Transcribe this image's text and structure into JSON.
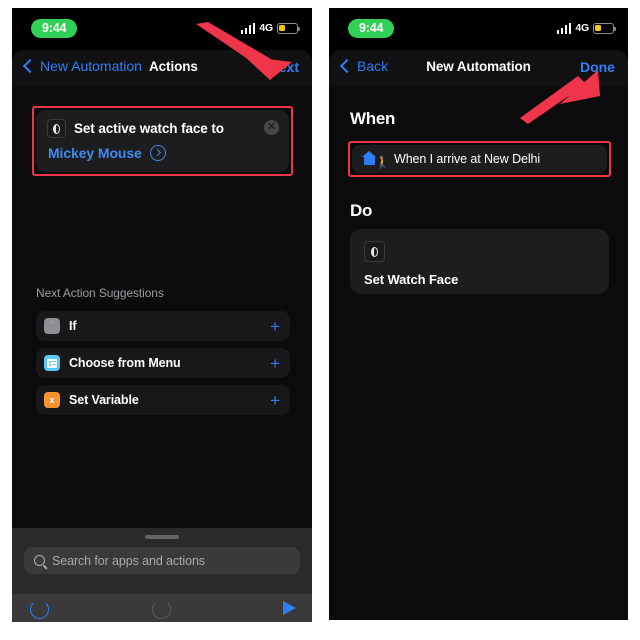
{
  "status_bar": {
    "time": "9:44",
    "carrier": "4G",
    "signal_icon": "cellular-bars-icon",
    "battery_icon": "battery-low-power-icon",
    "battery_color": "#f5c518"
  },
  "accent": {
    "blue": "#2f7ef6",
    "link_blue": "#3c8af0",
    "annotation_red": "#f0344a",
    "green_pill": "#31d158"
  },
  "left_phone": {
    "nav": {
      "back_label": "New Automation",
      "title": "Actions",
      "action_label": "Next"
    },
    "action_card": {
      "icon": "watch-face-icon",
      "title": "Set active watch face to",
      "parameter_value": "Mickey Mouse",
      "disclosure_icon": "chevron-right-circle-icon",
      "remove_icon": "remove-circle-icon",
      "remove_glyph": "✕"
    },
    "suggestions": {
      "label": "Next Action Suggestions",
      "items": [
        {
          "label": "If",
          "icon": "if-condition-icon",
          "glyph": "֔",
          "add_glyph": "+"
        },
        {
          "label": "Choose from Menu",
          "icon": "choose-from-menu-icon",
          "glyph": "",
          "add_glyph": "+"
        },
        {
          "label": "Set Variable",
          "icon": "set-variable-icon",
          "glyph": "x",
          "add_glyph": "+"
        }
      ]
    },
    "search": {
      "placeholder": "Search for apps and actions",
      "icon": "search-icon"
    },
    "toolbar": {
      "undo_icon": "undo-icon",
      "redo_icon": "redo-icon",
      "play_icon": "play-icon"
    }
  },
  "right_phone": {
    "nav": {
      "back_label": "Back",
      "title": "New Automation",
      "action_label": "Done"
    },
    "when_section": {
      "heading": "When",
      "trigger_icon": "home-arrive-icon",
      "trigger_text": "When I arrive at New Delhi"
    },
    "do_section": {
      "heading": "Do",
      "action_icon": "watch-face-icon",
      "action_label": "Set Watch Face"
    }
  },
  "annotations": [
    {
      "name": "arrow-pointing-to-next",
      "target": "Next"
    },
    {
      "name": "arrow-pointing-to-done",
      "target": "Done"
    }
  ]
}
